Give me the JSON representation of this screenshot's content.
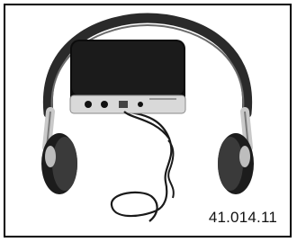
{
  "product": {
    "code": "41.014.11",
    "image_subject": "headphones-with-receiver-box"
  }
}
